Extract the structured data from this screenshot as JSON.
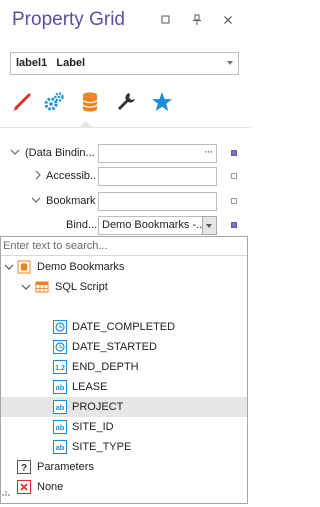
{
  "window": {
    "title": "Property Grid",
    "buttons": [
      "restore",
      "pin",
      "close"
    ]
  },
  "selector": {
    "value": "label1   Label"
  },
  "tabs": [
    {
      "name": "appearance",
      "icon": "brush-icon"
    },
    {
      "name": "behavior",
      "icon": "gears-icon"
    },
    {
      "name": "data",
      "icon": "database-icon",
      "selected": true
    },
    {
      "name": "design",
      "icon": "wrench-icon"
    },
    {
      "name": "favorites",
      "icon": "star-icon"
    }
  ],
  "properties": [
    {
      "name": "(Data Bindin...",
      "expanded": true,
      "value": "",
      "has_ellipsis": true,
      "marker": "filled"
    },
    {
      "name": "Accessib...",
      "expanded": false,
      "value": "",
      "marker": "hollow"
    },
    {
      "name": "Bookmark",
      "expanded": true,
      "value": "",
      "marker": "hollow"
    },
    {
      "name": "Bind...",
      "value": "Demo Bookmarks -...",
      "is_combo": true,
      "marker": "filled"
    }
  ],
  "dropdown": {
    "search_placeholder": "Enter text to search...",
    "tree": [
      {
        "label": "Demo Bookmarks",
        "icon": "datasource-icon",
        "level": 0,
        "expanded": true
      },
      {
        "label": "SQL Script",
        "icon": "table-icon",
        "level": 1,
        "expanded": true
      },
      {
        "label": "DATE_COMPLETED",
        "icon": "datetime-field-icon",
        "level": 2
      },
      {
        "label": "DATE_STARTED",
        "icon": "datetime-field-icon",
        "level": 2
      },
      {
        "label": "END_DEPTH",
        "icon": "numeric-field-icon",
        "level": 2
      },
      {
        "label": "LEASE",
        "icon": "string-field-icon",
        "level": 2
      },
      {
        "label": "PROJECT",
        "icon": "string-field-icon",
        "level": 2,
        "selected": true
      },
      {
        "label": "SITE_ID",
        "icon": "string-field-icon",
        "level": 2
      },
      {
        "label": "SITE_TYPE",
        "icon": "string-field-icon",
        "level": 2
      },
      {
        "label": "Parameters",
        "icon": "parameters-icon",
        "level": 0
      },
      {
        "label": "None",
        "icon": "none-icon",
        "level": 0
      }
    ]
  },
  "colors": {
    "title": "#5b4fa3",
    "accent_blue": "#1e8fd6",
    "accent_orange": "#f0821e",
    "accent_red": "#d9322b",
    "selection": "#e6e6e6"
  }
}
